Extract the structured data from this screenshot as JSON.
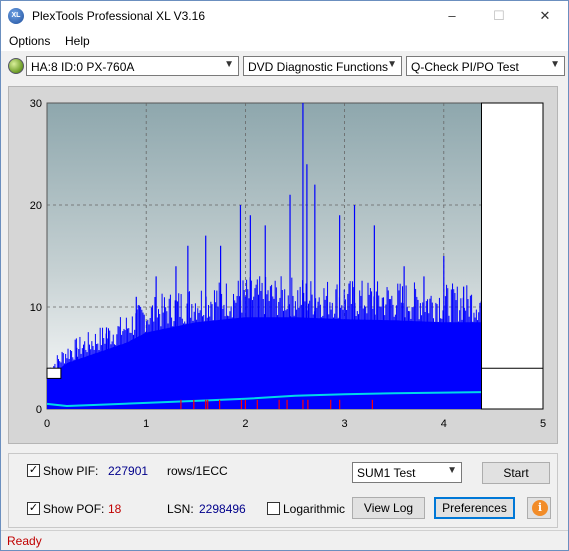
{
  "window": {
    "title": "PlexTools Professional XL V3.16",
    "icon_text": "XL",
    "minimize_glyph": "–",
    "maximize_glyph": "☐",
    "close_glyph": "✕"
  },
  "menu": {
    "items": [
      "Options",
      "Help"
    ]
  },
  "toolbar": {
    "drive": "HA:8 ID:0  PX-760A",
    "function": "DVD Diagnostic Functions",
    "test": "Q-Check PI/PO Test",
    "arrow_glyph": "▼"
  },
  "chart_data": {
    "type": "bar",
    "x_ticks": [
      "0",
      "1",
      "2",
      "3",
      "4",
      "5"
    ],
    "y_ticks": [
      "0",
      "10",
      "20",
      "30"
    ],
    "xlim": [
      0,
      5
    ],
    "ylim": [
      0,
      30
    ],
    "data_end_x": 4.38,
    "grid": true,
    "colors": {
      "pif": "#0000ff",
      "pof": "#ff0000",
      "sum_line": "#00d8e8",
      "plot_bg_top": "#8ea7ad",
      "plot_bg_bottom": "#ffffff"
    },
    "series": [
      {
        "name": "PIF",
        "description_points": [
          [
            0,
            3.0
          ],
          [
            0.2,
            4.5
          ],
          [
            0.5,
            5.5
          ],
          [
            0.8,
            6.5
          ],
          [
            1.0,
            7.5
          ],
          [
            1.5,
            8.5
          ],
          [
            2.0,
            9.0
          ],
          [
            2.5,
            9.0
          ],
          [
            3.0,
            8.8
          ],
          [
            3.5,
            8.7
          ],
          [
            4.0,
            8.5
          ],
          [
            4.38,
            8.5
          ]
        ],
        "spikes": [
          [
            0.3,
            6
          ],
          [
            0.6,
            8
          ],
          [
            0.9,
            11
          ],
          [
            1.1,
            13
          ],
          [
            1.3,
            14
          ],
          [
            1.42,
            16
          ],
          [
            1.6,
            17
          ],
          [
            1.75,
            16
          ],
          [
            1.95,
            20
          ],
          [
            2.05,
            19
          ],
          [
            2.2,
            18
          ],
          [
            2.45,
            21
          ],
          [
            2.58,
            30
          ],
          [
            2.62,
            24
          ],
          [
            2.7,
            22
          ],
          [
            2.95,
            19
          ],
          [
            3.1,
            20
          ],
          [
            3.3,
            18
          ],
          [
            3.6,
            14
          ],
          [
            3.8,
            13
          ],
          [
            4.0,
            15
          ],
          [
            4.2,
            12
          ]
        ]
      },
      {
        "name": "SUM1",
        "points": [
          [
            0,
            0.5
          ],
          [
            0.2,
            0.3
          ],
          [
            0.5,
            0.4
          ],
          [
            1.0,
            0.6
          ],
          [
            1.5,
            0.8
          ],
          [
            2.0,
            1.0
          ],
          [
            2.5,
            1.3
          ],
          [
            3.0,
            1.45
          ],
          [
            3.5,
            1.55
          ],
          [
            4.0,
            1.6
          ],
          [
            4.38,
            1.65
          ]
        ]
      },
      {
        "name": "POF",
        "x_positions": [
          1.35,
          1.48,
          1.6,
          1.62,
          1.74,
          1.96,
          2.0,
          2.12,
          2.34,
          2.42,
          2.58,
          2.63,
          2.86,
          2.95,
          3.28
        ]
      }
    ],
    "marker_box": {
      "x_start": 4.38,
      "x_end": 5.0,
      "y_value": 4.0
    }
  },
  "controls": {
    "show_pif_label": "Show PIF:",
    "pif_value": "227901",
    "pif_unit": "rows/1ECC",
    "show_pof_label": "Show POF:",
    "pof_value": "18",
    "lsn_label": "LSN:",
    "lsn_value": "2298496",
    "logarithmic_label": "Logarithmic",
    "sum_test_option": "SUM1 Test",
    "start_label": "Start",
    "view_log_label": "View Log",
    "preferences_label": "Preferences",
    "info_glyph": "i",
    "check_glyph": "✓",
    "show_pif_checked": true,
    "show_pof_checked": true,
    "logarithmic_checked": false,
    "pif_color": "#00008b",
    "pof_color": "#c00000"
  },
  "status": {
    "text": "Ready"
  }
}
